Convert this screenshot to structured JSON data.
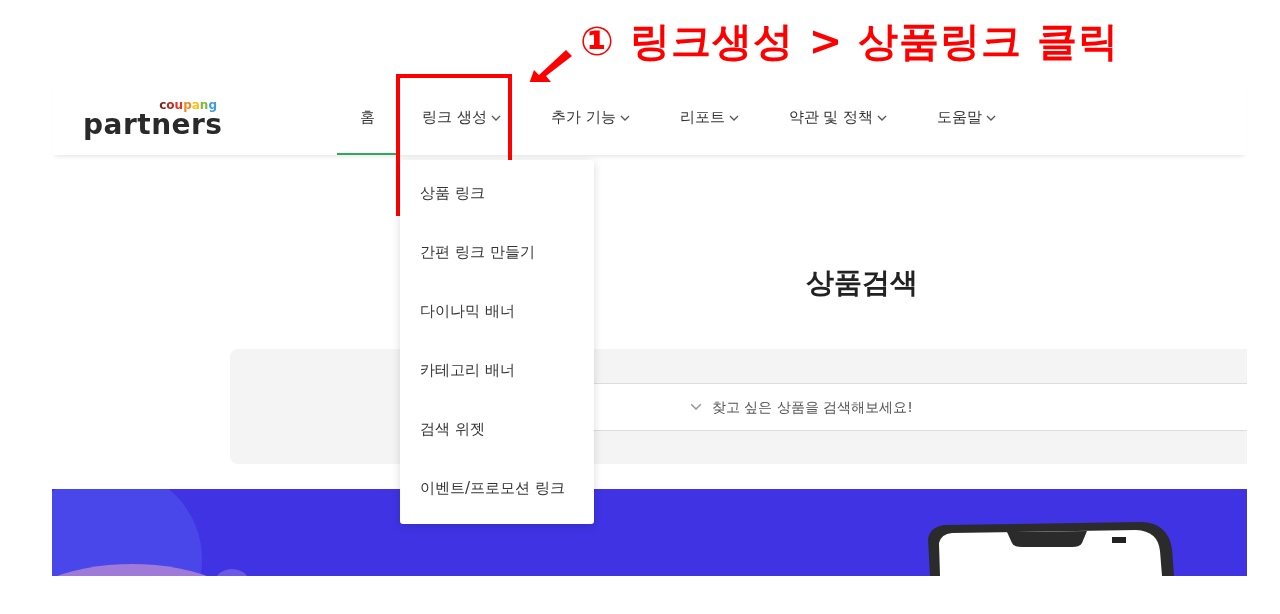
{
  "annotation": {
    "text": "① 링크생성 > 상품링크 클릭"
  },
  "logo": {
    "brand": "coupang",
    "name": "partners"
  },
  "nav": [
    {
      "label": "홈",
      "selected": true,
      "has_menu": false,
      "highlighted": false
    },
    {
      "label": "링크 생성",
      "selected": false,
      "has_menu": true,
      "highlighted": true
    },
    {
      "label": "추가 기능",
      "selected": false,
      "has_menu": true,
      "highlighted": false
    },
    {
      "label": "리포트",
      "selected": false,
      "has_menu": true,
      "highlighted": false
    },
    {
      "label": "약관 및 정책",
      "selected": false,
      "has_menu": true,
      "highlighted": false
    },
    {
      "label": "도움말",
      "selected": false,
      "has_menu": true,
      "highlighted": false
    }
  ],
  "dropdown": {
    "items": [
      {
        "label": "상품 링크"
      },
      {
        "label": "간편 링크 만들기"
      },
      {
        "label": "다이나믹 배너"
      },
      {
        "label": "카테고리 배너"
      },
      {
        "label": "검색 위젯"
      },
      {
        "label": "이벤트/프로모션 링크"
      }
    ]
  },
  "title": "상품검색",
  "search": {
    "placeholder": "찾고 싶은 상품을 검색해보세요!"
  }
}
